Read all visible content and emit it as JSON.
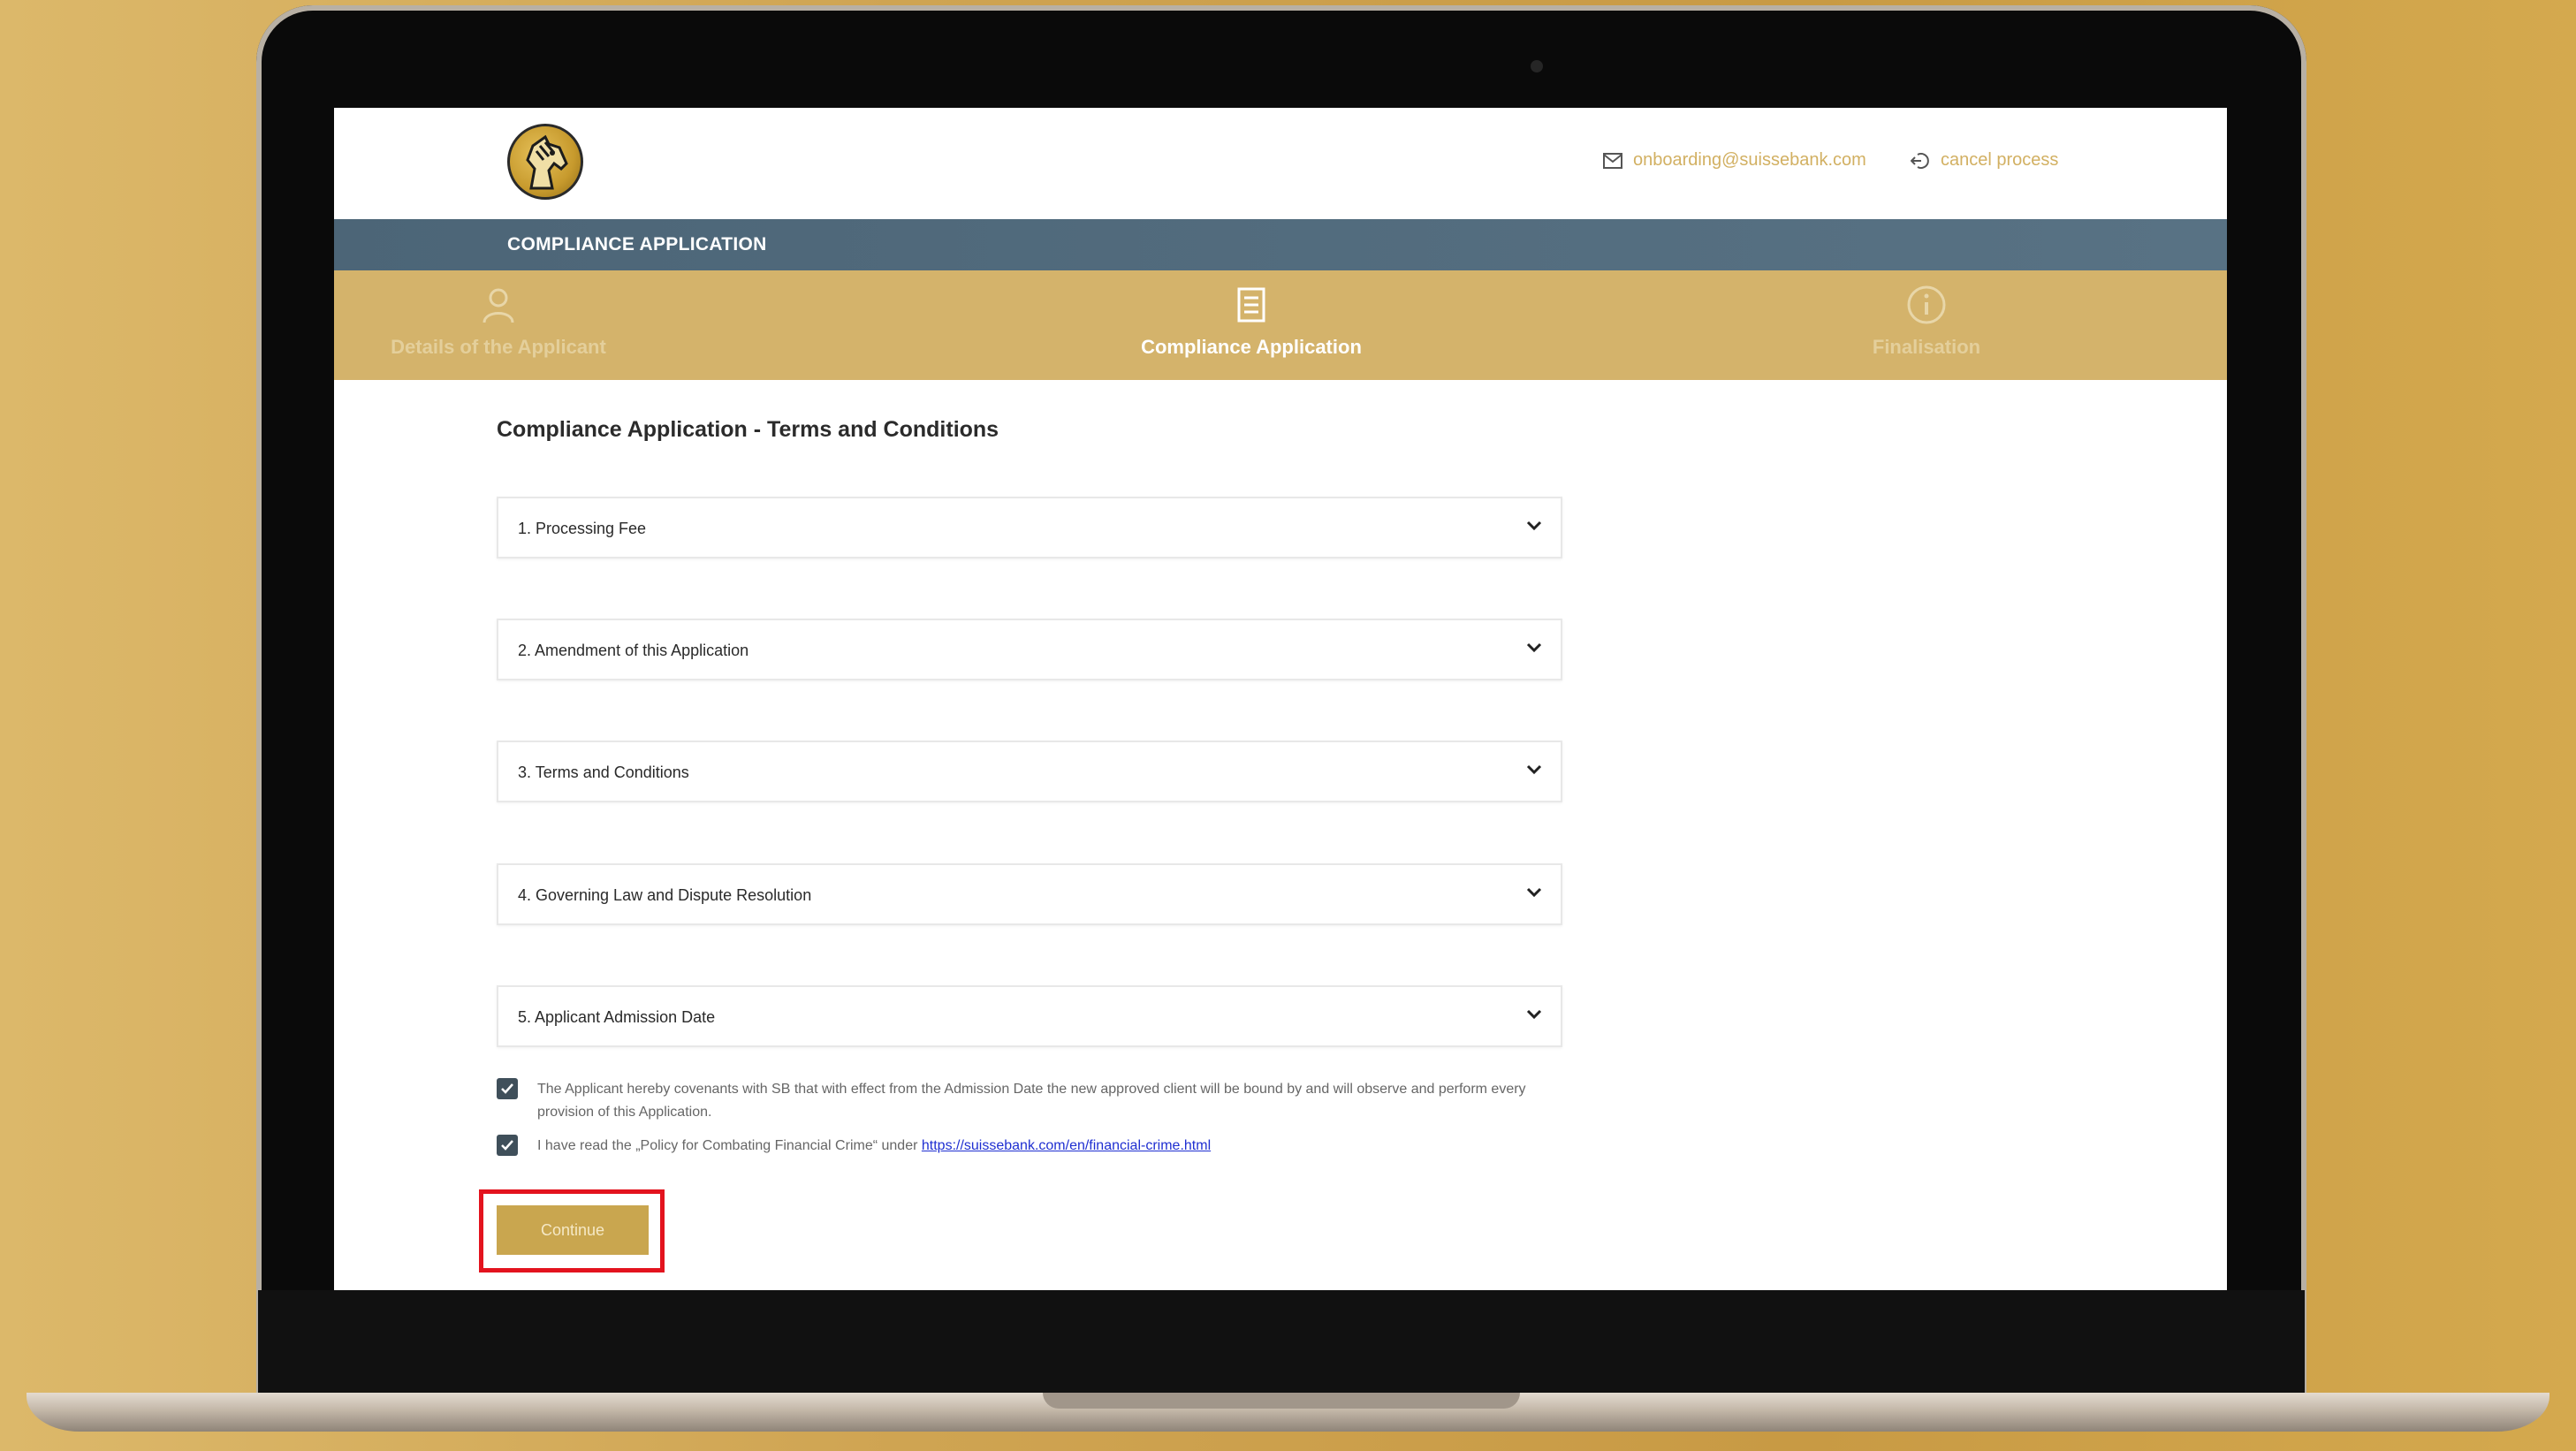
{
  "header": {
    "email": "onboarding@suissebank.com",
    "cancel_label": "cancel process"
  },
  "banner": {
    "title": "COMPLIANCE APPLICATION"
  },
  "steps": [
    {
      "label": "Details of the Applicant",
      "icon": "user-icon",
      "state": "inactive"
    },
    {
      "label": "Compliance Application",
      "icon": "document-icon",
      "state": "active"
    },
    {
      "label": "Finalisation",
      "icon": "info-icon",
      "state": "inactive"
    }
  ],
  "main": {
    "heading": "Compliance Application - Terms and Conditions",
    "sections": [
      {
        "label": "1. Processing Fee"
      },
      {
        "label": "2. Amendment of this Application"
      },
      {
        "label": "3. Terms and Conditions"
      },
      {
        "label": "4. Governing Law and Dispute Resolution"
      },
      {
        "label": "5. Applicant Admission Date"
      }
    ],
    "consent1": "The Applicant hereby covenants with SB that with effect from the Admission Date the new approved client will be bound by and will observe and perform every provision of this Application.",
    "consent2_prefix": "I have read the „Policy for Combating Financial Crime“ under",
    "consent2_link": "https://suissebank.com/en/financial-crime.html",
    "continue_label": "Continue"
  },
  "colors": {
    "gold": "#d4b36b",
    "banner": "#4c6577",
    "button": "#c9a64f",
    "highlight": "#e3131e"
  }
}
